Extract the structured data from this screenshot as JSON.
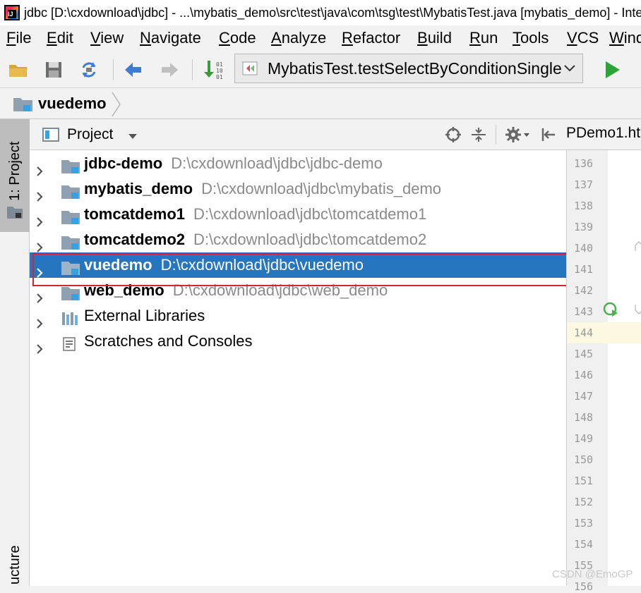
{
  "window": {
    "title": "jdbc [D:\\cxdownload\\jdbc] - ...\\mybatis_demo\\src\\test\\java\\com\\tsg\\test\\MybatisTest.java [mybatis_demo] - IntelliJ IDEA"
  },
  "menu": {
    "items": [
      "File",
      "Edit",
      "View",
      "Navigate",
      "Code",
      "Analyze",
      "Refactor",
      "Build",
      "Run",
      "Tools",
      "VCS",
      "Window"
    ]
  },
  "toolbar": {
    "run_config": "MybatisTest.testSelectByConditionSingle",
    "icons": [
      "open-folder-icon",
      "save-all-icon",
      "sync-icon",
      "back-arrow-icon",
      "forward-arrow-icon",
      "build-icon",
      "run-icon"
    ],
    "colors": {
      "back": "#3d7bd4",
      "run": "#2fa33a",
      "build": "#3c9a3c"
    }
  },
  "breadcrumb": {
    "label": "vuedemo"
  },
  "side_strip": {
    "project_tab": "1: Project",
    "structure_tab": "ucture"
  },
  "project_panel": {
    "title": "Project",
    "tree": [
      {
        "name": "jdbc-demo",
        "path": "D:\\cxdownload\\jdbc\\jdbc-demo",
        "bold": true,
        "selected": false
      },
      {
        "name": "mybatis_demo",
        "path": "D:\\cxdownload\\jdbc\\mybatis_demo",
        "bold": true,
        "selected": false
      },
      {
        "name": "tomcatdemo1",
        "path": "D:\\cxdownload\\jdbc\\tomcatdemo1",
        "bold": true,
        "selected": false
      },
      {
        "name": "tomcatdemo2",
        "path": "D:\\cxdownload\\jdbc\\tomcatdemo2",
        "bold": true,
        "selected": false
      },
      {
        "name": "vuedemo",
        "path": "D:\\cxdownload\\jdbc\\vuedemo",
        "bold": true,
        "selected": true
      },
      {
        "name": "web_demo",
        "path": "D:\\cxdownload\\jdbc\\web_demo",
        "bold": true,
        "selected": false
      },
      {
        "name": "External Libraries",
        "path": "",
        "bold": false,
        "selected": false
      },
      {
        "name": "Scratches and Consoles",
        "path": "",
        "bold": false,
        "selected": false
      }
    ],
    "selection_color": "#2675bf",
    "highlight_color": "#d9232e"
  },
  "editor": {
    "tab_label": "PDemo1.ht",
    "line_numbers": [
      "136",
      "137",
      "138",
      "139",
      "140",
      "141",
      "142",
      "143",
      "144",
      "145",
      "146",
      "147",
      "148",
      "149",
      "150",
      "151",
      "152",
      "153",
      "154",
      "155",
      "156"
    ]
  },
  "watermark": "CSDN @EmoGP"
}
